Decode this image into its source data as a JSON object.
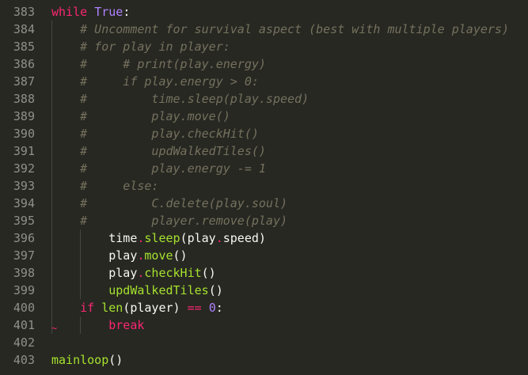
{
  "editor": {
    "lines": [
      {
        "num": "383",
        "tokens": [
          [
            "kw",
            "while"
          ],
          [
            "txt",
            " "
          ],
          [
            "cst",
            "True"
          ],
          [
            "txt",
            ":"
          ]
        ]
      },
      {
        "num": "384",
        "tokens": [
          [
            "txt",
            "    "
          ],
          [
            "cmt",
            "# Uncomment for survival aspect (best with multiple players)"
          ]
        ]
      },
      {
        "num": "385",
        "tokens": [
          [
            "txt",
            "    "
          ],
          [
            "cmt",
            "# for play in player:"
          ]
        ]
      },
      {
        "num": "386",
        "tokens": [
          [
            "txt",
            "    "
          ],
          [
            "cmt",
            "#     # print(play.energy)"
          ]
        ]
      },
      {
        "num": "387",
        "tokens": [
          [
            "txt",
            "    "
          ],
          [
            "cmt",
            "#     if play.energy > 0:"
          ]
        ]
      },
      {
        "num": "388",
        "tokens": [
          [
            "txt",
            "    "
          ],
          [
            "cmt",
            "#         time.sleep(play.speed)"
          ]
        ]
      },
      {
        "num": "389",
        "tokens": [
          [
            "txt",
            "    "
          ],
          [
            "cmt",
            "#         play.move()"
          ]
        ]
      },
      {
        "num": "390",
        "tokens": [
          [
            "txt",
            "    "
          ],
          [
            "cmt",
            "#         play.checkHit()"
          ]
        ]
      },
      {
        "num": "391",
        "tokens": [
          [
            "txt",
            "    "
          ],
          [
            "cmt",
            "#         updWalkedTiles()"
          ]
        ]
      },
      {
        "num": "392",
        "tokens": [
          [
            "txt",
            "    "
          ],
          [
            "cmt",
            "#         play.energy -= 1"
          ]
        ]
      },
      {
        "num": "393",
        "tokens": [
          [
            "txt",
            "    "
          ],
          [
            "cmt",
            "#     else:"
          ]
        ]
      },
      {
        "num": "394",
        "tokens": [
          [
            "txt",
            "    "
          ],
          [
            "cmt",
            "#         C.delete(play.soul)"
          ]
        ]
      },
      {
        "num": "395",
        "tokens": [
          [
            "txt",
            "    "
          ],
          [
            "cmt",
            "#         player.remove(play)"
          ]
        ]
      },
      {
        "num": "396",
        "tokens": [
          [
            "txt",
            "        time"
          ],
          [
            "op",
            "."
          ],
          [
            "fn",
            "sleep"
          ],
          [
            "txt",
            "(play"
          ],
          [
            "op",
            "."
          ],
          [
            "txt",
            "speed)"
          ]
        ]
      },
      {
        "num": "397",
        "tokens": [
          [
            "txt",
            "        play"
          ],
          [
            "op",
            "."
          ],
          [
            "fn",
            "move"
          ],
          [
            "txt",
            "()"
          ]
        ]
      },
      {
        "num": "398",
        "tokens": [
          [
            "txt",
            "        play"
          ],
          [
            "op",
            "."
          ],
          [
            "fn",
            "checkHit"
          ],
          [
            "txt",
            "()"
          ]
        ]
      },
      {
        "num": "399",
        "tokens": [
          [
            "txt",
            "        "
          ],
          [
            "fn",
            "updWalkedTiles"
          ],
          [
            "txt",
            "()"
          ]
        ]
      },
      {
        "num": "400",
        "tokens": [
          [
            "txt",
            "    "
          ],
          [
            "kw",
            "if"
          ],
          [
            "txt",
            " "
          ],
          [
            "fn",
            "len"
          ],
          [
            "txt",
            "(player) "
          ],
          [
            "op",
            "=="
          ],
          [
            "txt",
            " "
          ],
          [
            "cst",
            "0"
          ],
          [
            "txt",
            ":"
          ]
        ]
      },
      {
        "num": "401",
        "tokens": [
          [
            "txt",
            "        "
          ],
          [
            "kw",
            "break"
          ]
        ],
        "squiggle": "~"
      },
      {
        "num": "402",
        "tokens": []
      },
      {
        "num": "403",
        "tokens": [
          [
            "fn",
            "mainloop"
          ],
          [
            "txt",
            "()"
          ]
        ]
      }
    ],
    "colors": {
      "background": "#272822",
      "keyword": "#f92672",
      "constant": "#ae81ff",
      "function": "#a6e22e",
      "comment": "#75715e",
      "text": "#f8f8f2",
      "gutter": "#8f908a"
    }
  }
}
